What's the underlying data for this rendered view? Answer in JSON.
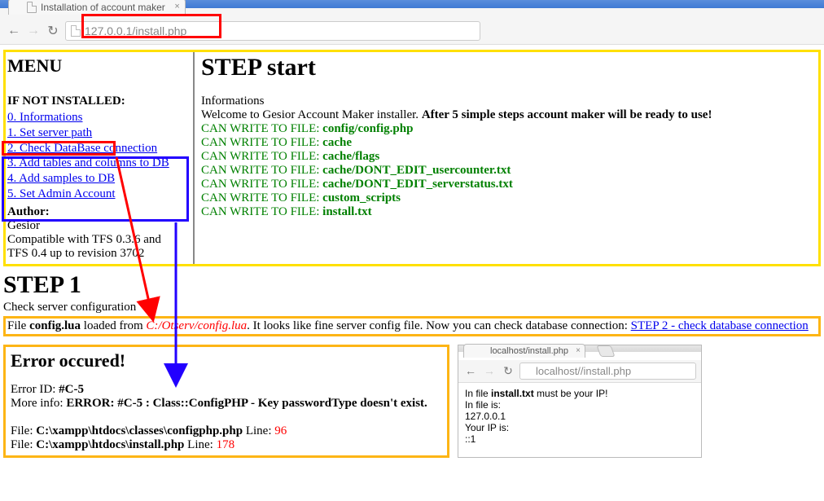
{
  "browser": {
    "tab_title": "Installation of account maker",
    "url": "127.0.0.1/install.php"
  },
  "menu": {
    "heading": "MENU",
    "subheading": "IF NOT INSTALLED:",
    "items": [
      "0. Informations",
      "1. Set server path",
      "2. Check DataBase connection",
      "3. Add tables and columns to DB",
      "4. Add samples to DB",
      "5. Set Admin Account"
    ],
    "author_label": "Author:",
    "author": "Gesior",
    "compat1": "Compatible with TFS 0.3.6 and",
    "compat2": "TFS 0.4 up to revision 3702"
  },
  "step_start": {
    "title": "STEP start",
    "info_label": "Informations",
    "welcome_pre": "Welcome to Gesior Account Maker installer. ",
    "welcome_bold": "After 5 simple steps account maker will be ready to use!",
    "canwrite_prefix": "CAN WRITE TO FILE: ",
    "files": [
      "config/config.php",
      "cache",
      "cache/flags",
      "cache/DONT_EDIT_usercounter.txt",
      "cache/DONT_EDIT_serverstatus.txt",
      "custom_scripts",
      "install.txt"
    ]
  },
  "step1": {
    "title": "STEP 1",
    "subtitle": "Check server configuration",
    "line_pre": "File ",
    "line_file": "config.lua",
    "line_mid": " loaded from ",
    "line_path": "C:/Otserv/config.lua",
    "line_post": ". It looks like fine server config file. Now you can check database connection: ",
    "line_link": "STEP 2 - check database connection"
  },
  "error": {
    "title": "Error occured!",
    "id_label": "Error ID: ",
    "id_value": "#C-5",
    "more_label": "More info: ",
    "more_value": "ERROR: #C-5 : Class::ConfigPHP - Key passwordType doesn't exist.",
    "file_label": "File: ",
    "line_label": "   Line: ",
    "files": [
      {
        "path": "C:\\xampp\\htdocs\\classes\\configphp.php",
        "line": "96"
      },
      {
        "path": "C:\\xampp\\htdocs\\install.php",
        "line": "178"
      }
    ]
  },
  "mini": {
    "tab_title": "localhost/install.php",
    "url": "localhost//install.php",
    "l1a": "In file ",
    "l1b": "install.txt",
    "l1c": " must be your IP!",
    "l2": "In file is:",
    "l3": "127.0.0.1",
    "l4": "Your IP is:",
    "l5": "::1"
  }
}
